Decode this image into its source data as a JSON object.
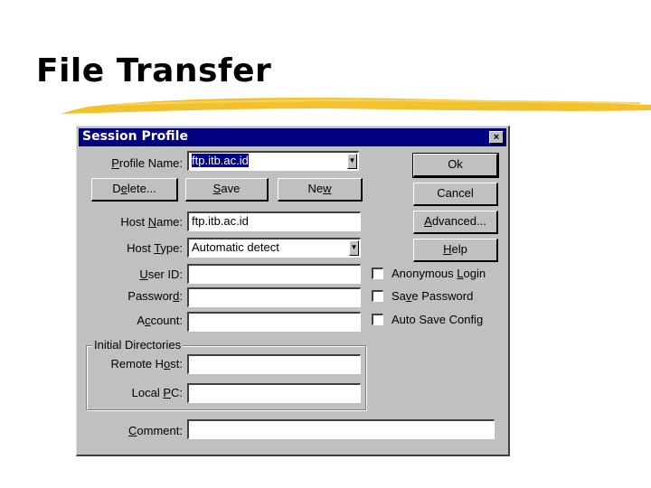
{
  "slide": {
    "title": "File Transfer",
    "accent_color": "#f2c12e"
  },
  "dialog": {
    "title": "Session Profile",
    "close_icon": "close-x-icon",
    "profile_name": {
      "label_pre": "",
      "label_key": "P",
      "label_post": "rofile Name:",
      "value": "ftp.itb.ac.id"
    },
    "buttons": {
      "delete": {
        "pre": "D",
        "key": "e",
        "post": "lete..."
      },
      "save": {
        "pre": "",
        "key": "S",
        "post": "ave"
      },
      "new": {
        "pre": "Ne",
        "key": "w",
        "post": ""
      },
      "ok": {
        "label": "Ok"
      },
      "cancel": {
        "label": "Cancel"
      },
      "advanced": {
        "pre": "",
        "key": "A",
        "post": "dvanced..."
      },
      "help": {
        "pre": "",
        "key": "H",
        "post": "elp"
      }
    },
    "host_name": {
      "label_pre": "Host ",
      "label_key": "N",
      "label_post": "ame:",
      "value": "ftp.itb.ac.id"
    },
    "host_type": {
      "label_pre": "Host ",
      "label_key": "T",
      "label_post": "ype:",
      "value": "Automatic detect"
    },
    "user_id": {
      "label_pre": "",
      "label_key": "U",
      "label_post": "ser ID:",
      "value": ""
    },
    "password": {
      "label_pre": "Passwor",
      "label_key": "d",
      "label_post": ":",
      "value": ""
    },
    "account": {
      "label_pre": "A",
      "label_key": "c",
      "label_post": "count:",
      "value": ""
    },
    "checkboxes": [
      {
        "pre": "Anonymous ",
        "key": "L",
        "post": "ogin",
        "checked": false
      },
      {
        "pre": "Sa",
        "key": "v",
        "post": "e Password",
        "checked": false
      },
      {
        "pre": "Auto Save Config",
        "key": "",
        "post": "",
        "checked": false
      }
    ],
    "initial_directories": {
      "group_label": "Initial Directories",
      "remote_host": {
        "label_pre": "Remote H",
        "label_key": "o",
        "label_post": "st:",
        "value": ""
      },
      "local_pc": {
        "label_pre": "Local ",
        "label_key": "P",
        "label_post": "C:",
        "value": ""
      }
    },
    "comment": {
      "label_pre": "",
      "label_key": "C",
      "label_post": "omment:",
      "value": ""
    }
  }
}
